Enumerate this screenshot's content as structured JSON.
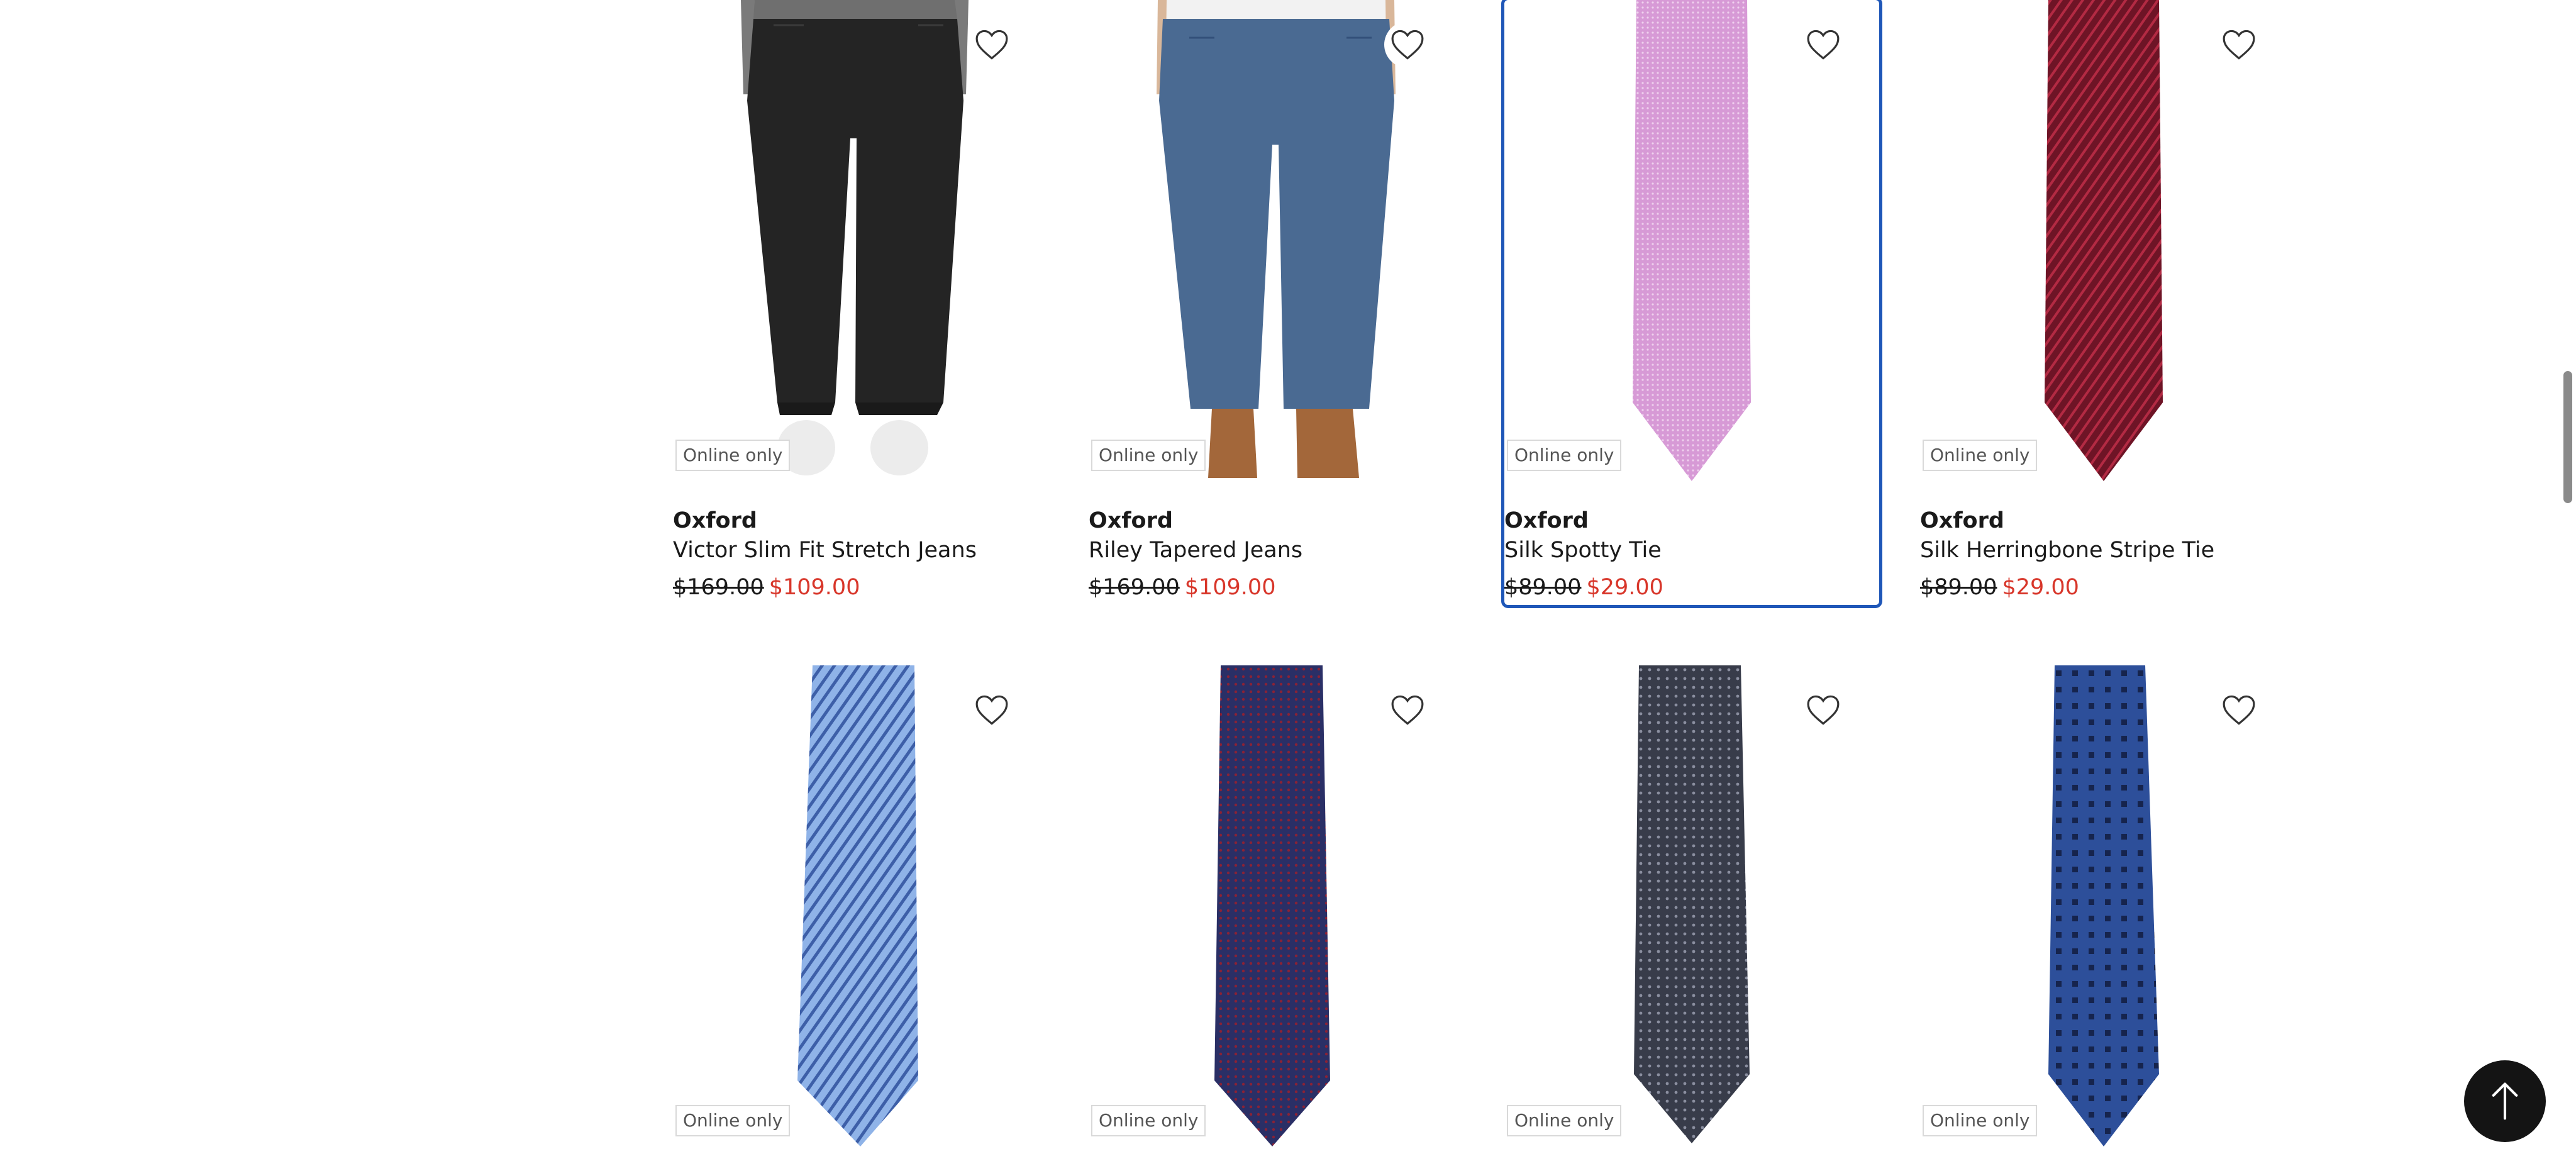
{
  "badge_text": "Online only",
  "colors": {
    "sale_price": "#d8362a",
    "focus_outline": "#1f57b8",
    "back_to_top_bg": "#141414"
  },
  "icons": {
    "wishlist": "heart-outline-icon",
    "back_to_top": "arrow-up-icon"
  },
  "products": [
    {
      "brand": "Oxford",
      "name": "Victor Slim Fit Stretch Jeans",
      "was_price": "$169.00",
      "sale_price": "$109.00",
      "image": "black-jeans",
      "focused": false
    },
    {
      "brand": "Oxford",
      "name": "Riley Tapered Jeans",
      "was_price": "$169.00",
      "sale_price": "$109.00",
      "image": "blue-jeans",
      "focused": false
    },
    {
      "brand": "Oxford",
      "name": "Silk Spotty Tie",
      "was_price": "$89.00",
      "sale_price": "$29.00",
      "image": "lilac-tie",
      "focused": true
    },
    {
      "brand": "Oxford",
      "name": "Silk Herringbone Stripe Tie",
      "was_price": "$89.00",
      "sale_price": "$29.00",
      "image": "burgundy-stripe-tie",
      "focused": false
    },
    {
      "image": "light-blue-stripe-tie"
    },
    {
      "image": "navy-red-dot-tie"
    },
    {
      "image": "charcoal-dot-tie"
    },
    {
      "image": "blue-square-tie"
    }
  ]
}
